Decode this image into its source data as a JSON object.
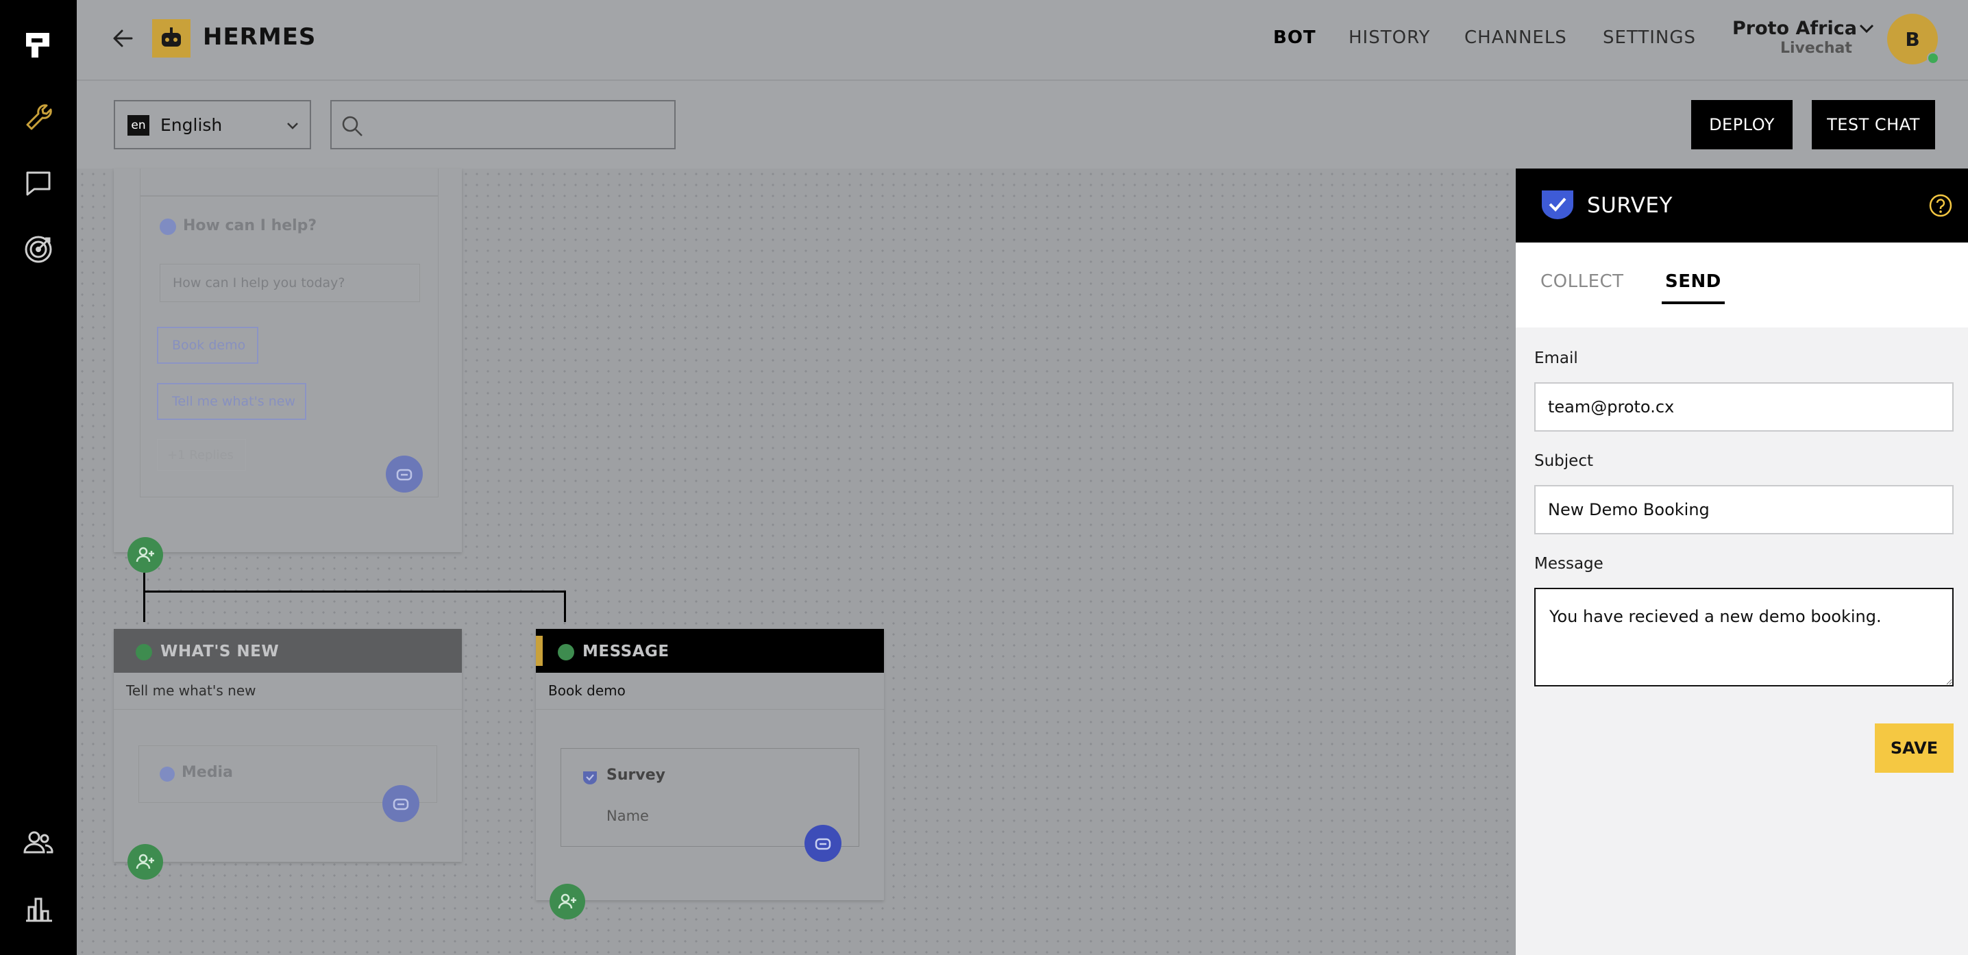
{
  "app": {
    "title": "HERMES",
    "back_icon": "arrow-left-icon",
    "logo_icon": "bot-logo-icon"
  },
  "nav": {
    "items": [
      {
        "label": "BOT",
        "active": true
      },
      {
        "label": "HISTORY",
        "active": false
      },
      {
        "label": "CHANNELS",
        "active": false
      },
      {
        "label": "SETTINGS",
        "active": false
      }
    ]
  },
  "account": {
    "name": "Proto Africa",
    "sub": "Livechat",
    "avatar_letter": "B",
    "status_color": "#3eaa56"
  },
  "toolbar": {
    "language_code": "en",
    "language": "English",
    "search_placeholder": "",
    "deploy_label": "DEPLOY",
    "test_chat_label": "TEST CHAT"
  },
  "canvas": {
    "top_card": {
      "question_title": "How can I help?",
      "question_text": "How can I help you today?",
      "replies": [
        "Book demo",
        "Tell me what's new"
      ],
      "more_replies": "+1 Replies"
    },
    "whats_new_node": {
      "header": "WHAT'S NEW",
      "trigger": "Tell me what's new",
      "block_title": "Media"
    },
    "message_node": {
      "header": "MESSAGE",
      "trigger": "Book demo",
      "block_title": "Survey",
      "block_field": "Name"
    }
  },
  "panel": {
    "title": "SURVEY",
    "help_icon": "help-circle-icon",
    "tabs": [
      {
        "label": "COLLECT",
        "active": false
      },
      {
        "label": "SEND",
        "active": true
      }
    ],
    "email_label": "Email",
    "email_value": "team@proto.cx",
    "subject_label": "Subject",
    "subject_value": "New Demo Booking",
    "message_label": "Message",
    "message_value": "You have recieved a new demo booking.",
    "save_label": "SAVE"
  },
  "colors": {
    "accent_yellow": "#f5c842",
    "brand_blue": "#3e5bd6",
    "green": "#3e8c4f"
  }
}
